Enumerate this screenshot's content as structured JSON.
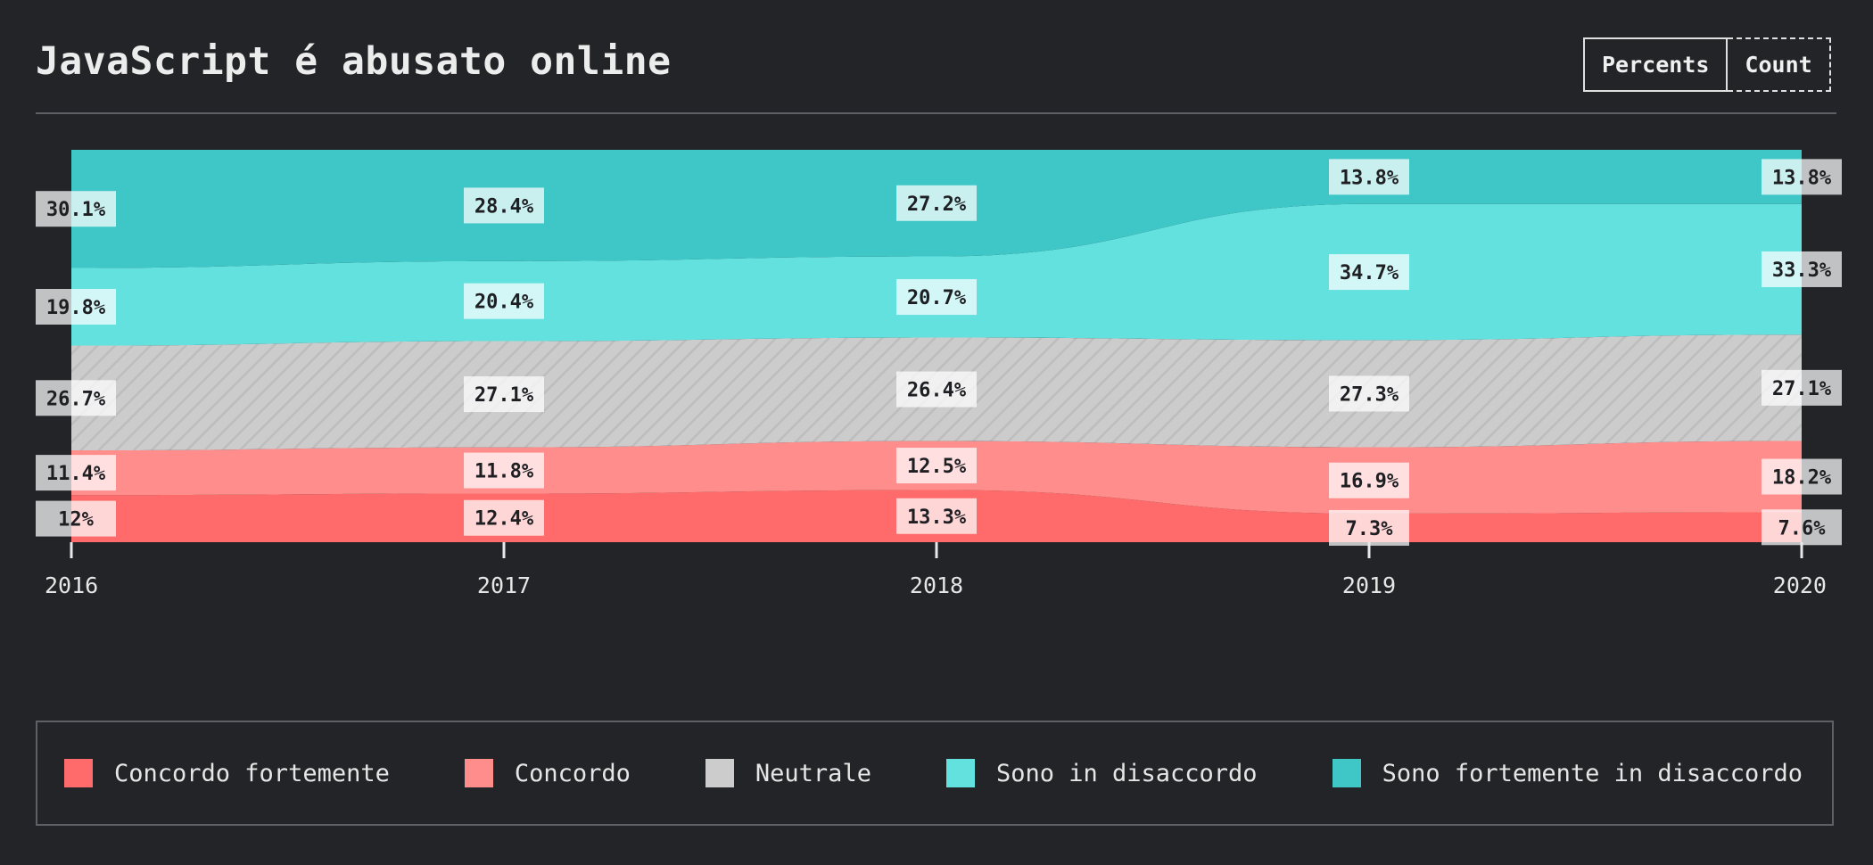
{
  "title": "JavaScript é abusato online",
  "toggle": {
    "percents_label": "Percents",
    "count_label": "Count",
    "active": "Percents"
  },
  "chart_data": {
    "type": "area",
    "x": [
      "2016",
      "2017",
      "2018",
      "2019",
      "2020"
    ],
    "series": [
      {
        "name": "Concordo fortemente",
        "color": "#ff6b6b",
        "values": [
          12,
          12.4,
          13.3,
          7.3,
          7.6
        ],
        "labels": [
          "12%",
          "12.4%",
          "13.3%",
          "7.3%",
          "7.6%"
        ]
      },
      {
        "name": "Concordo",
        "color": "#ff8d8b",
        "values": [
          11.4,
          11.8,
          12.5,
          16.9,
          18.2
        ],
        "labels": [
          "11.4%",
          "11.8%",
          "12.5%",
          "16.9%",
          "18.2%"
        ]
      },
      {
        "name": "Neutrale",
        "color": "#cccccc",
        "pattern": "diagonal-hatch",
        "values": [
          26.7,
          27.1,
          26.4,
          27.3,
          27.1
        ],
        "labels": [
          "26.7%",
          "27.1%",
          "26.4%",
          "27.3%",
          "27.1%"
        ]
      },
      {
        "name": "Sono in disaccordo",
        "color": "#63e1df",
        "values": [
          19.8,
          20.4,
          20.7,
          34.7,
          33.3
        ],
        "labels": [
          "19.8%",
          "20.4%",
          "20.7%",
          "34.7%",
          "33.3%"
        ]
      },
      {
        "name": "Sono fortemente in disaccordo",
        "color": "#3fc6c6",
        "values": [
          30.1,
          28.4,
          27.2,
          13.8,
          13.8
        ],
        "labels": [
          "30.1%",
          "28.4%",
          "27.2%",
          "13.8%",
          "13.8%"
        ]
      }
    ],
    "ylim": [
      0,
      100
    ],
    "stacked": true,
    "legend_position": "bottom"
  }
}
